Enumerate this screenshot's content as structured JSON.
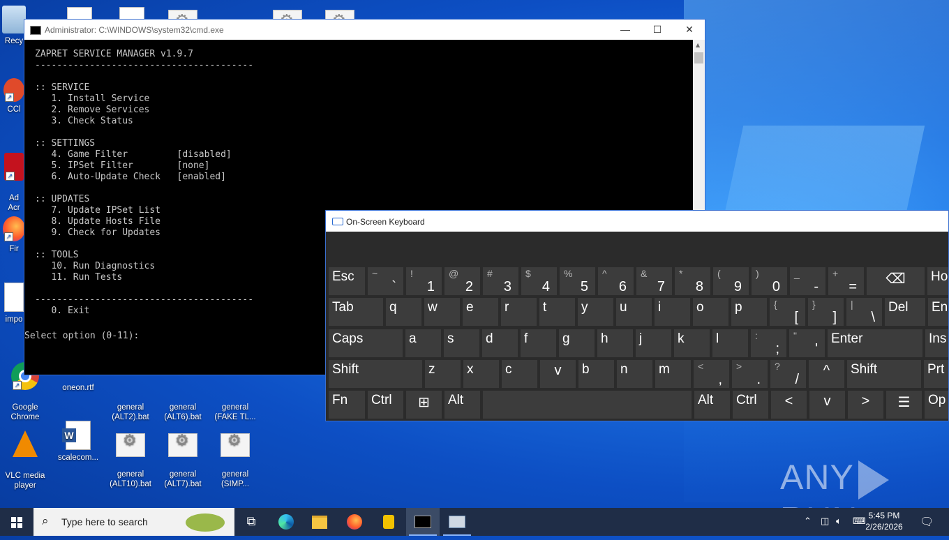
{
  "desktop": {
    "icons": [
      {
        "label": "Recy"
      },
      {
        "label": "CCl"
      },
      {
        "label": "Ad\nAcr"
      },
      {
        "label": "Fir"
      },
      {
        "label": "impo"
      },
      {
        "label": "Google\nChrome"
      },
      {
        "label": "oneon.rtf"
      },
      {
        "label": "general\n(ALT2).bat"
      },
      {
        "label": "general\n(ALT6).bat"
      },
      {
        "label": "general\n(FAKE TL..."
      },
      {
        "label": "VLC media\nplayer"
      },
      {
        "label": "scalecom..."
      },
      {
        "label": "general\n(ALT10).bat"
      },
      {
        "label": "general\n(ALT7).bat"
      },
      {
        "label": "general\n(SIMP..."
      }
    ]
  },
  "cmd": {
    "title": "Administrator: C:\\WINDOWS\\system32\\cmd.exe",
    "minimize": "—",
    "maximize": "☐",
    "close": "✕",
    "console_text": "ZAPRET SERVICE MANAGER v1.9.7\n----------------------------------------\n\n:: SERVICE\n   1. Install Service\n   2. Remove Services\n   3. Check Status\n\n:: SETTINGS\n   4. Game Filter         [disabled]\n   5. IPSet Filter        [none]\n   6. Auto-Update Check   [enabled]\n\n:: UPDATES\n   7. Update IPSet List\n   8. Update Hosts File\n   9. Check for Updates\n\n:: TOOLS\n   10. Run Diagnostics\n   11. Run Tests\n\n----------------------------------------\n   0. Exit",
    "prompt": "Select option (0-11):"
  },
  "osk": {
    "title": "On-Screen Keyboard",
    "rows": [
      [
        {
          "label": "Esc"
        },
        {
          "label": "`",
          "shift": "~"
        },
        {
          "label": "1",
          "shift": "!"
        },
        {
          "label": "2",
          "shift": "@"
        },
        {
          "label": "3",
          "shift": "#"
        },
        {
          "label": "4",
          "shift": "$"
        },
        {
          "label": "5",
          "shift": "%"
        },
        {
          "label": "6",
          "shift": "^"
        },
        {
          "label": "7",
          "shift": "&"
        },
        {
          "label": "8",
          "shift": "*"
        },
        {
          "label": "9",
          "shift": "("
        },
        {
          "label": "0",
          "shift": ")"
        },
        {
          "label": "-",
          "shift": "_"
        },
        {
          "label": "=",
          "shift": "+"
        },
        {
          "label": "⌫"
        },
        {
          "label": "Ho"
        }
      ],
      [
        {
          "label": "Tab"
        },
        {
          "label": "q"
        },
        {
          "label": "w"
        },
        {
          "label": "e"
        },
        {
          "label": "r"
        },
        {
          "label": "t"
        },
        {
          "label": "y"
        },
        {
          "label": "u"
        },
        {
          "label": "i"
        },
        {
          "label": "o"
        },
        {
          "label": "p"
        },
        {
          "label": "[",
          "shift": "{"
        },
        {
          "label": "]",
          "shift": "}"
        },
        {
          "label": "\\",
          "shift": "|"
        },
        {
          "label": "Del"
        },
        {
          "label": "En"
        }
      ],
      [
        {
          "label": "Caps"
        },
        {
          "label": "a"
        },
        {
          "label": "s"
        },
        {
          "label": "d"
        },
        {
          "label": "f"
        },
        {
          "label": "g"
        },
        {
          "label": "h"
        },
        {
          "label": "j"
        },
        {
          "label": "k"
        },
        {
          "label": "l"
        },
        {
          "label": ";",
          "shift": ":"
        },
        {
          "label": "'",
          "shift": "\""
        },
        {
          "label": "Enter"
        },
        {
          "label": "Ins"
        }
      ],
      [
        {
          "label": "Shift"
        },
        {
          "label": "z"
        },
        {
          "label": "x"
        },
        {
          "label": "c"
        },
        {
          "label": "v"
        },
        {
          "label": "b"
        },
        {
          "label": "n"
        },
        {
          "label": "m"
        },
        {
          "label": ",",
          "shift": "<"
        },
        {
          "label": ".",
          "shift": ">"
        },
        {
          "label": "/",
          "shift": "?"
        },
        {
          "label": "^"
        },
        {
          "label": "Shift"
        },
        {
          "label": "Prt"
        }
      ],
      [
        {
          "label": "Fn"
        },
        {
          "label": "Ctrl"
        },
        {
          "label": "⊞"
        },
        {
          "label": "Alt"
        },
        {
          "label": ""
        },
        {
          "label": "Alt"
        },
        {
          "label": "Ctrl"
        },
        {
          "label": "<"
        },
        {
          "label": "v"
        },
        {
          "label": ">"
        },
        {
          "label": "☰"
        },
        {
          "label": "Op"
        }
      ]
    ]
  },
  "watermark": {
    "left": "ANY",
    "right": "RUN"
  },
  "taskbar": {
    "search_placeholder": "Type here to search",
    "time": "5:45 PM",
    "date": "2/26/2026"
  }
}
